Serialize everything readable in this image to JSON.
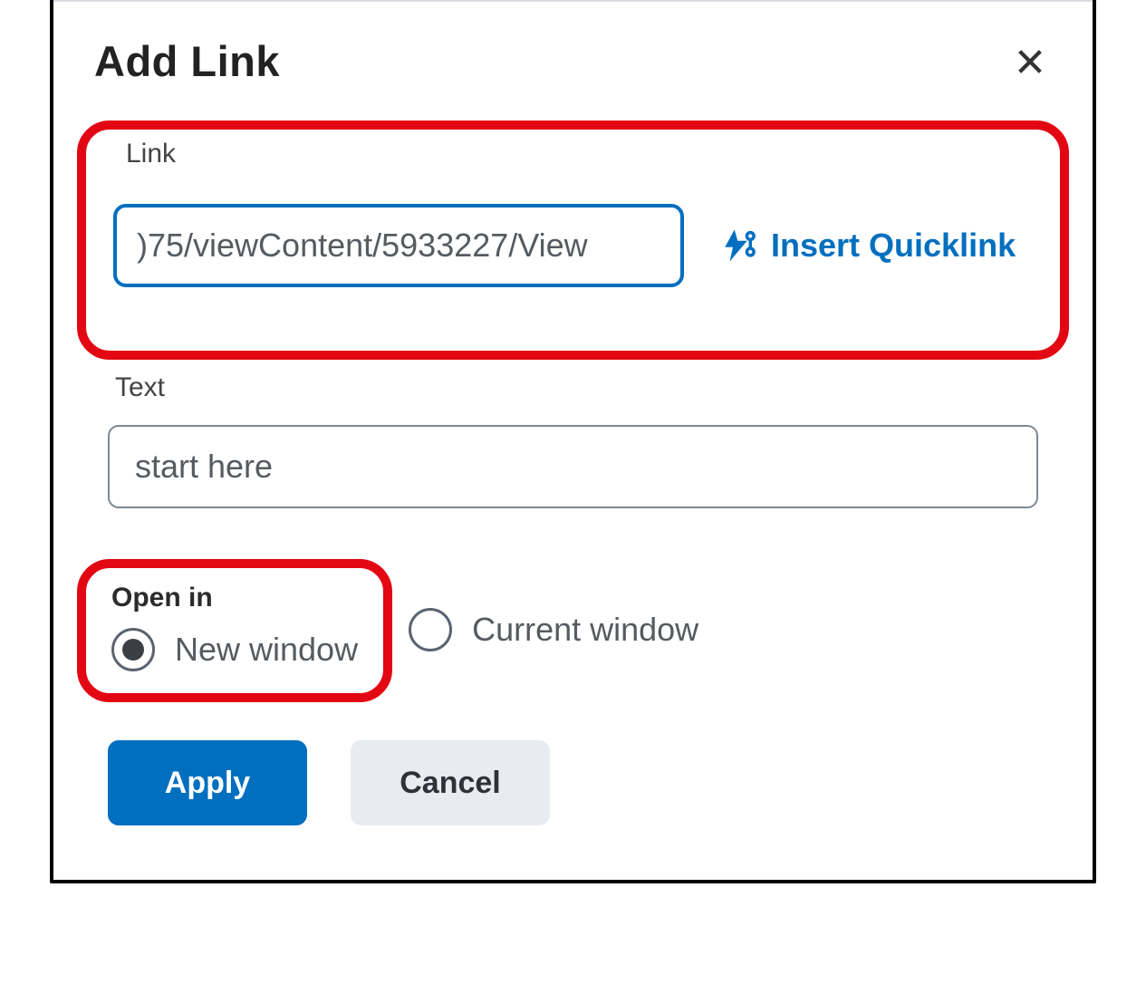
{
  "dialog": {
    "title": "Add Link"
  },
  "link_section": {
    "label": "Link",
    "value": ")75/viewContent/5933227/View",
    "quicklink_label": "Insert Quicklink"
  },
  "text_section": {
    "label": "Text",
    "value": "start here"
  },
  "openin_section": {
    "label": "Open in",
    "option_new": "New window",
    "option_current": "Current window",
    "selected": "new"
  },
  "buttons": {
    "apply": "Apply",
    "cancel": "Cancel"
  },
  "colors": {
    "accent": "#006fbf",
    "annotation": "#e30613"
  }
}
